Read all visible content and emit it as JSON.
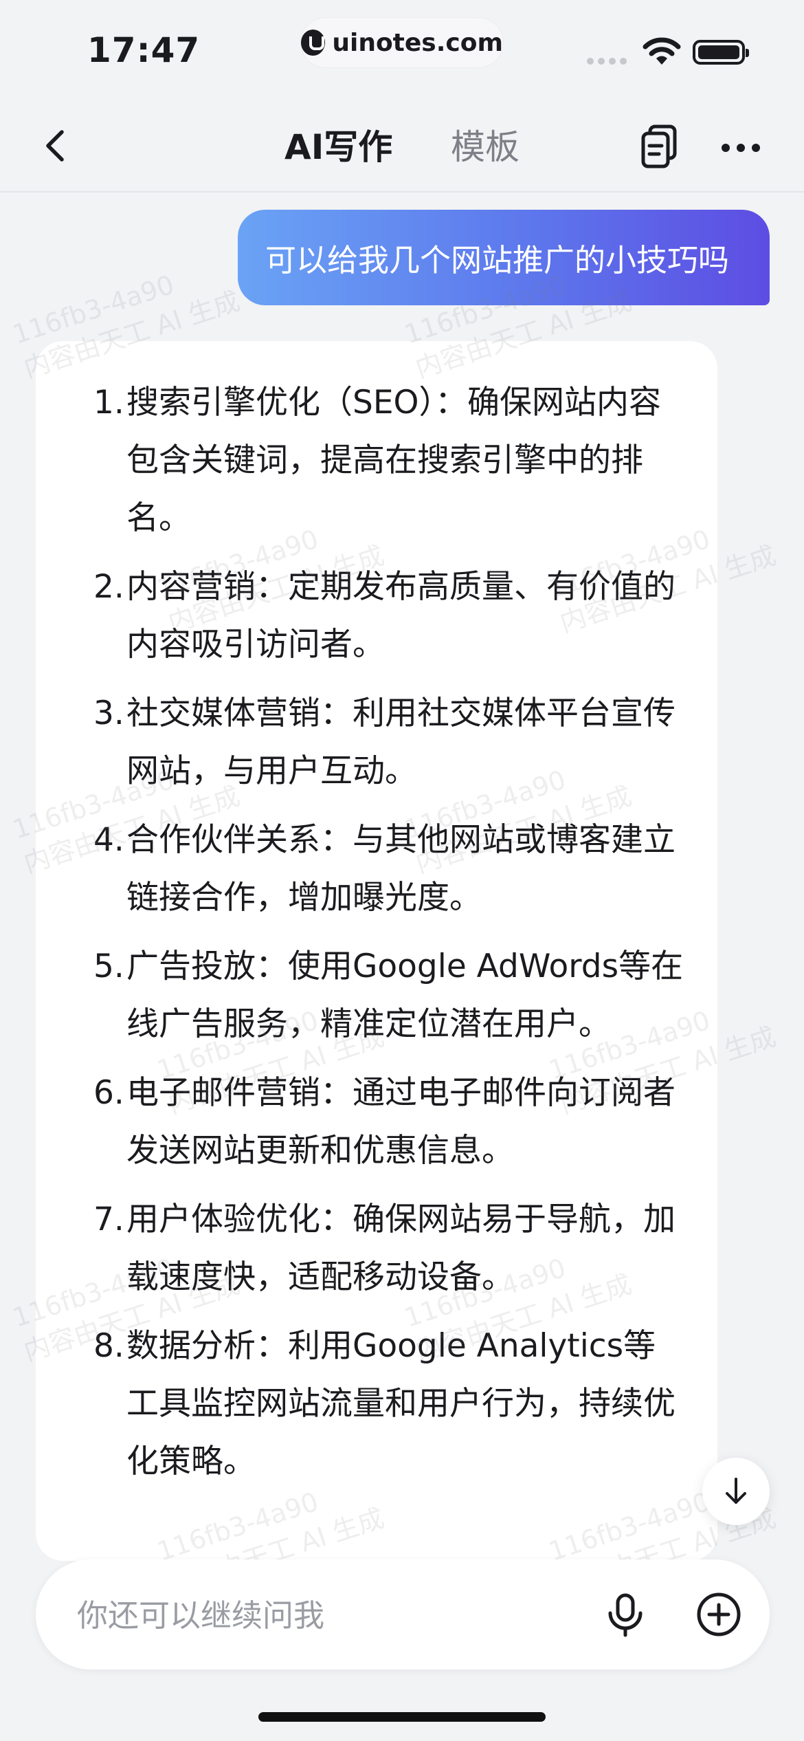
{
  "status_bar": {
    "time": "17:47",
    "url": "uinotes.com"
  },
  "nav": {
    "tab_active": "AI写作",
    "tab_other": "模板"
  },
  "user_message": "可以给我几个网站推广的小技巧吗",
  "ai_reply": {
    "items": [
      {
        "num": "1.",
        "text": "搜索引擎优化（SEO）：确保网站内容包含关键词，提高在搜索引擎中的排名。"
      },
      {
        "num": "2.",
        "text": "内容营销：定期发布高质量、有价值的内容吸引访问者。"
      },
      {
        "num": "3.",
        "text": "社交媒体营销：利用社交媒体平台宣传网站，与用户互动。"
      },
      {
        "num": "4.",
        "text": "合作伙伴关系：与其他网站或博客建立链接合作，增加曝光度。"
      },
      {
        "num": "5.",
        "text": "广告投放：使用Google AdWords等在线广告服务，精准定位潜在用户。"
      },
      {
        "num": "6.",
        "text": "电子邮件营销：通过电子邮件向订阅者发送网站更新和优惠信息。"
      },
      {
        "num": "7.",
        "text": "用户体验优化：确保网站易于导航，加载速度快，适配移动设备。"
      },
      {
        "num": "8.",
        "text": "数据分析：利用Google Analytics等工具监控网站流量和用户行为，持续优化策略。"
      }
    ]
  },
  "watermark": {
    "line1": "116fb3-4a90",
    "line2": "内容由天工 AI 生成"
  },
  "input": {
    "placeholder": "你还可以继续问我"
  },
  "colors": {
    "accent_start": "#6aa3f5",
    "accent_end": "#5d4de3",
    "background": "#f2f3f5"
  }
}
